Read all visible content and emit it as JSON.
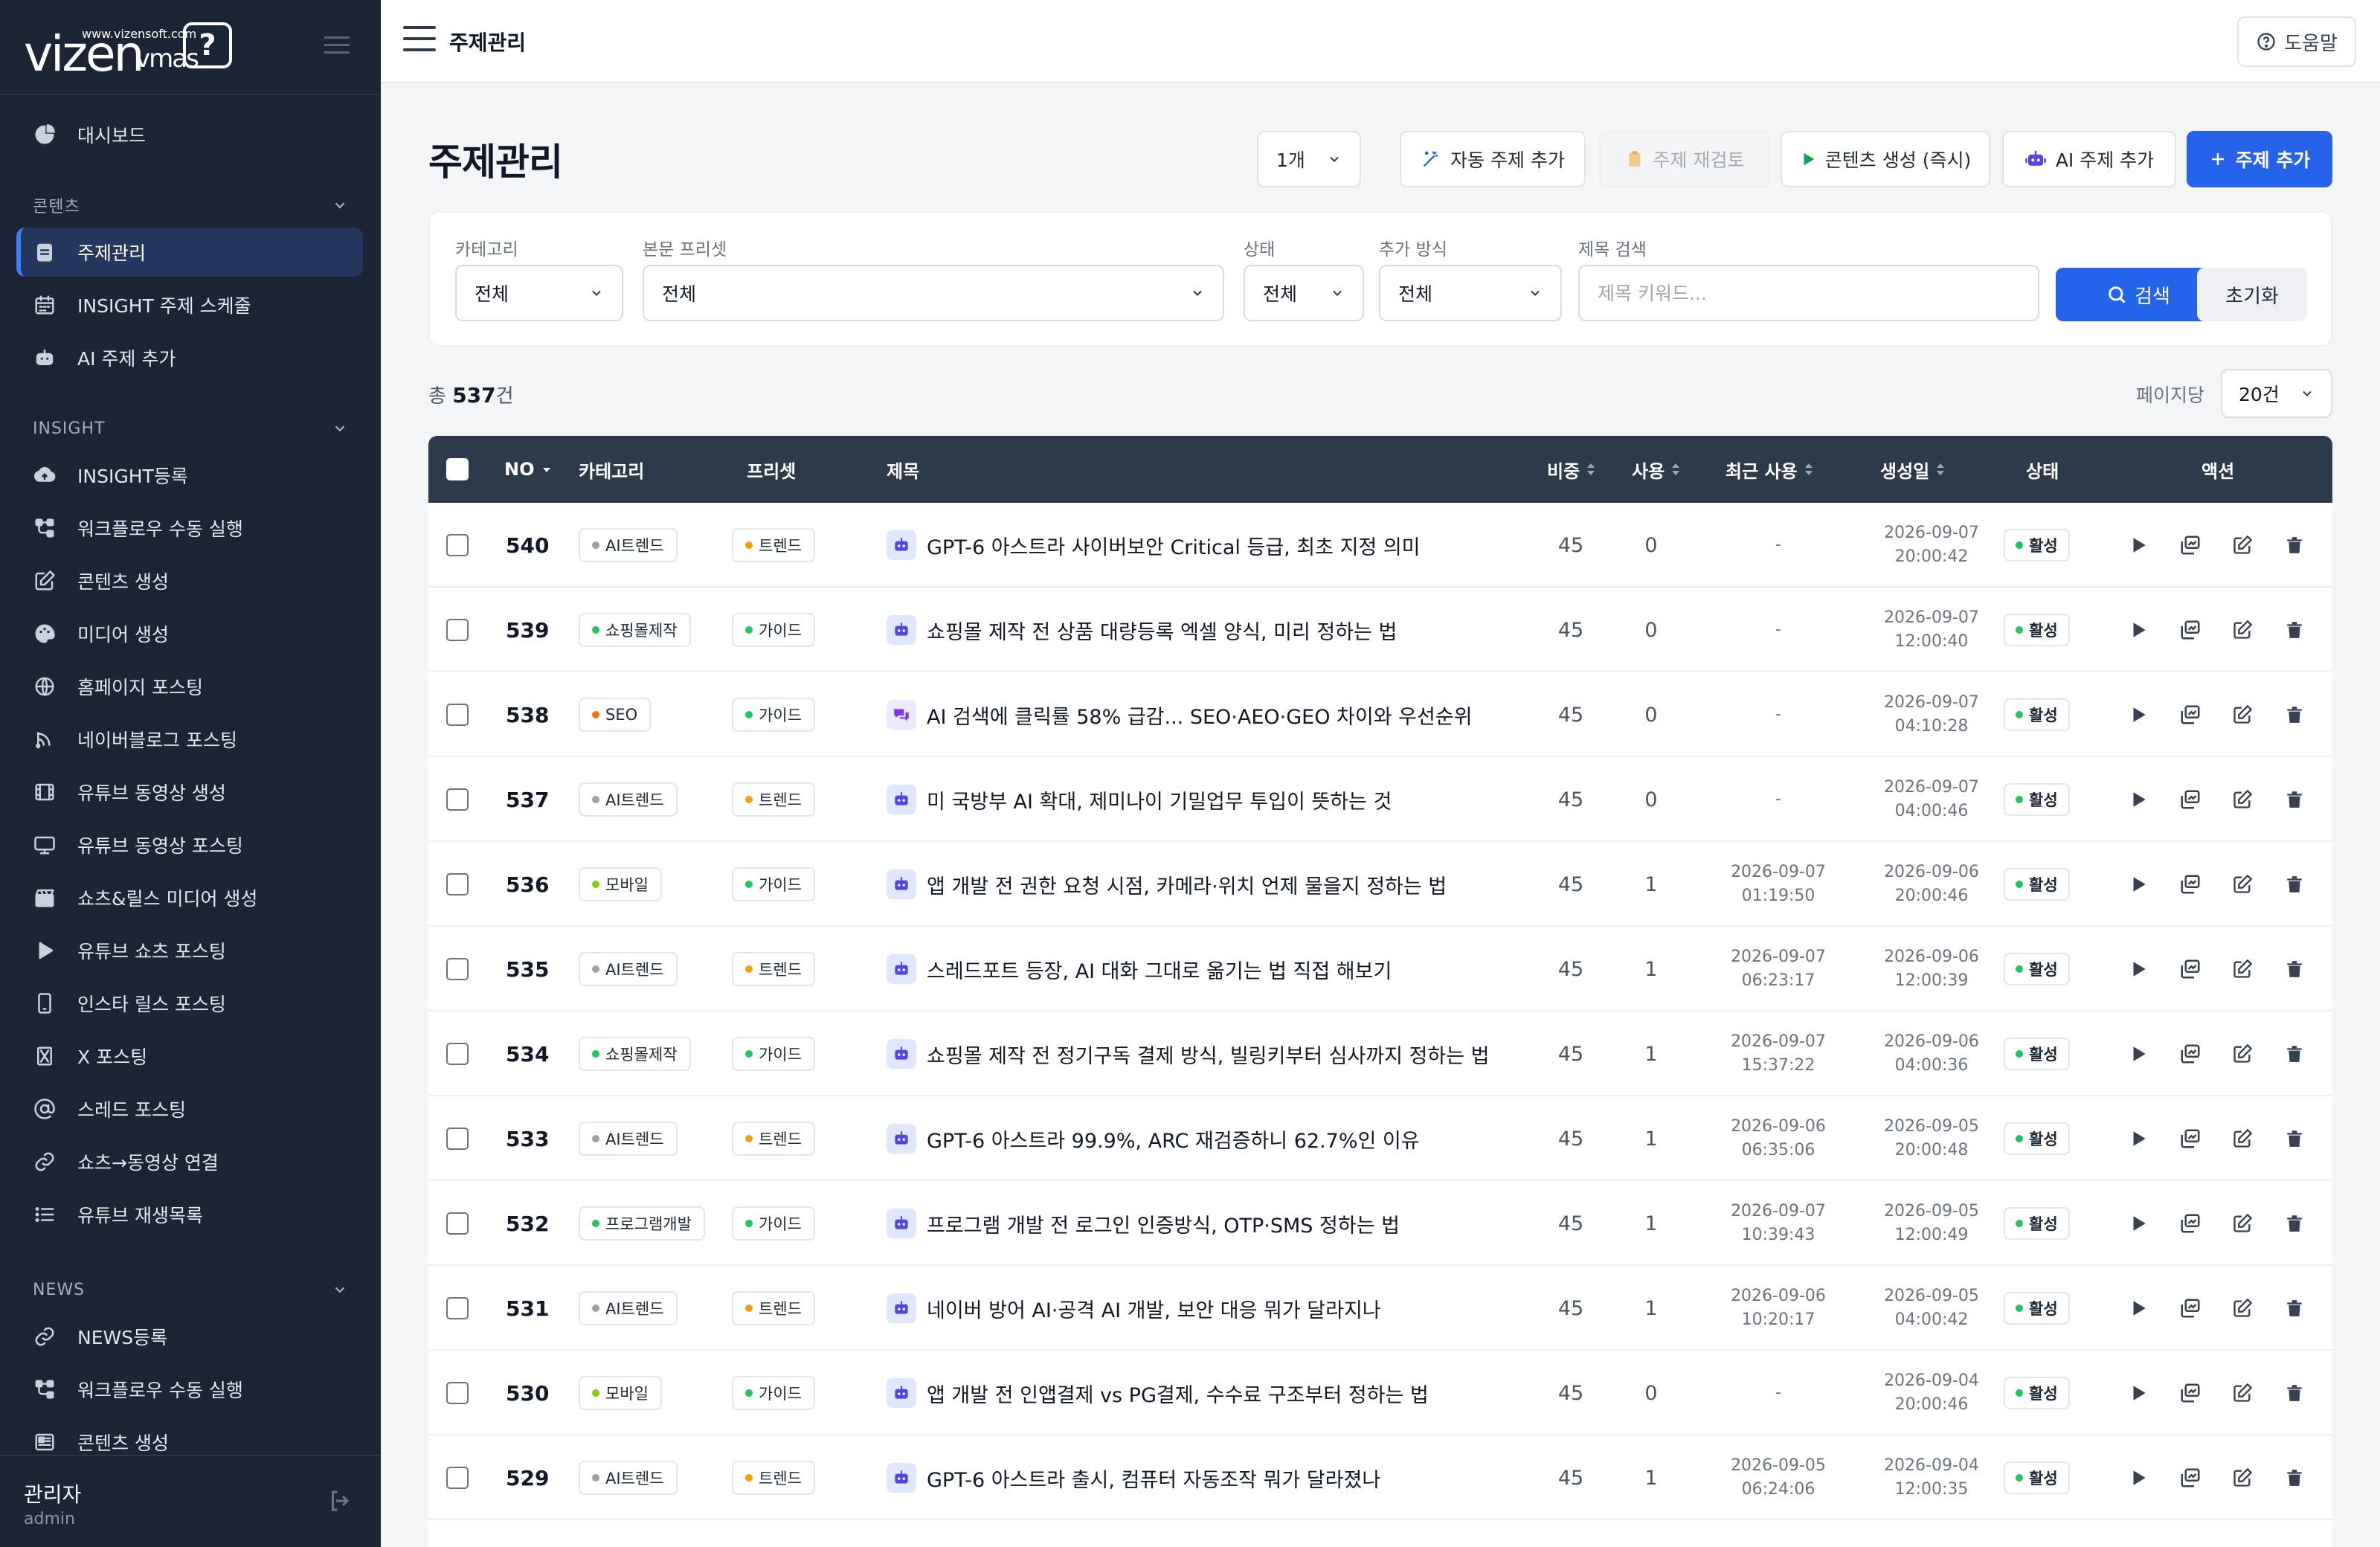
{
  "brand": {
    "url": "www.vizensoft.com",
    "name_main": "vizen",
    "name_sub": "vmas",
    "mark": "?"
  },
  "sidebar": {
    "top_items": [
      {
        "label": "대시보드",
        "icon": "pie-chart-icon"
      }
    ],
    "sections": [
      {
        "title": "콘텐츠",
        "items": [
          {
            "label": "주제관리",
            "icon": "clipboard-icon",
            "active": true
          },
          {
            "label": "INSIGHT 주제 스케줄",
            "icon": "calendar-icon"
          },
          {
            "label": "AI 주제 추가",
            "icon": "robot-icon"
          }
        ]
      },
      {
        "title": "INSIGHT",
        "items": [
          {
            "label": "INSIGHT등록",
            "icon": "cloud-upload-icon"
          },
          {
            "label": "워크플로우 수동 실행",
            "icon": "workflow-icon"
          },
          {
            "label": "콘텐츠 생성",
            "icon": "edit-icon"
          },
          {
            "label": "미디어 생성",
            "icon": "palette-icon"
          },
          {
            "label": "홈페이지 포스팅",
            "icon": "globe-icon"
          },
          {
            "label": "네이버블로그 포스팅",
            "icon": "blog-icon"
          },
          {
            "label": "유튜브 동영상 생성",
            "icon": "film-icon"
          },
          {
            "label": "유튜브 동영상 포스팅",
            "icon": "monitor-icon"
          },
          {
            "label": "쇼츠&릴스 미디어 생성",
            "icon": "clapper-icon"
          },
          {
            "label": "유튜브 쇼츠 포스팅",
            "icon": "play-icon"
          },
          {
            "label": "인스타 릴스 포스팅",
            "icon": "phone-icon"
          },
          {
            "label": "X 포스팅",
            "icon": "x-icon"
          },
          {
            "label": "스레드 포스팅",
            "icon": "at-icon"
          },
          {
            "label": "쇼츠→동영상 연결",
            "icon": "link-icon"
          },
          {
            "label": "유튜브 재생목록",
            "icon": "list-icon"
          }
        ]
      },
      {
        "title": "NEWS",
        "items": [
          {
            "label": "NEWS등록",
            "icon": "link-icon"
          },
          {
            "label": "워크플로우 수동 실행",
            "icon": "workflow-icon"
          },
          {
            "label": "콘텐츠 생성",
            "icon": "newspaper-icon"
          }
        ]
      }
    ],
    "user": {
      "name": "관리자",
      "role": "admin"
    }
  },
  "topbar": {
    "title": "주제관리",
    "help": "도움말"
  },
  "page": {
    "title": "주제관리"
  },
  "toolbar": {
    "count": "1개",
    "auto_add": "자동 주제 추가",
    "review": "주제 재검토",
    "generate": "콘텐츠 생성 (즉시)",
    "ai_add": "AI 주제 추가",
    "add": "주제 추가"
  },
  "filters": {
    "category": {
      "label": "카테고리",
      "value": "전체"
    },
    "preset": {
      "label": "본문 프리셋",
      "value": "전체"
    },
    "status": {
      "label": "상태",
      "value": "전체"
    },
    "method": {
      "label": "추가 방식",
      "value": "전체"
    },
    "search": {
      "label": "제목 검색",
      "placeholder": "제목 키워드..."
    },
    "search_btn": "검색",
    "reset_btn": "초기화"
  },
  "summary": {
    "prefix": "총",
    "total": "537",
    "suffix": "건",
    "per_page_label": "페이지당",
    "per_page": "20건"
  },
  "table": {
    "headers": {
      "no": "NO",
      "category": "카테고리",
      "preset": "프리셋",
      "title": "제목",
      "weight": "비중",
      "usage": "사용",
      "last_used": "최근 사용",
      "created": "생성일",
      "status": "상태",
      "actions": "액션"
    },
    "dot_colors": {
      "AI트렌드": "#9ca3af",
      "쇼핑몰제작": "#22c55e",
      "SEO": "#f97316",
      "모바일": "#84cc16",
      "프로그램개발": "#22c55e",
      "트렌드": "#f59e0b",
      "가이드": "#22c55e",
      "활성": "#22c55e"
    },
    "rows": [
      {
        "no": "540",
        "category": "AI트렌드",
        "preset": "트렌드",
        "icon": "robot",
        "title": "GPT-6 아스트라 사이버보안 Critical 등급, 최초 지정 의미",
        "weight": "45",
        "usage": "0",
        "last_used": [
          "-"
        ],
        "created": [
          "2026-09-07",
          "20:00:42"
        ],
        "status": "활성"
      },
      {
        "no": "539",
        "category": "쇼핑몰제작",
        "preset": "가이드",
        "icon": "robot",
        "title": "쇼핑몰 제작 전 상품 대량등록 엑셀 양식, 미리 정하는 법",
        "weight": "45",
        "usage": "0",
        "last_used": [
          "-"
        ],
        "created": [
          "2026-09-07",
          "12:00:40"
        ],
        "status": "활성"
      },
      {
        "no": "538",
        "category": "SEO",
        "preset": "가이드",
        "icon": "chat",
        "title": "AI 검색에 클릭률 58% 급감... SEO·AEO·GEO 차이와 우선순위",
        "weight": "45",
        "usage": "0",
        "last_used": [
          "-"
        ],
        "created": [
          "2026-09-07",
          "04:10:28"
        ],
        "status": "활성"
      },
      {
        "no": "537",
        "category": "AI트렌드",
        "preset": "트렌드",
        "icon": "robot",
        "title": "미 국방부 AI 확대, 제미나이 기밀업무 투입이 뜻하는 것",
        "weight": "45",
        "usage": "0",
        "last_used": [
          "-"
        ],
        "created": [
          "2026-09-07",
          "04:00:46"
        ],
        "status": "활성"
      },
      {
        "no": "536",
        "category": "모바일",
        "preset": "가이드",
        "icon": "robot",
        "title": "앱 개발 전 권한 요청 시점, 카메라·위치 언제 물을지 정하는 법",
        "weight": "45",
        "usage": "1",
        "last_used": [
          "2026-09-07",
          "01:19:50"
        ],
        "created": [
          "2026-09-06",
          "20:00:46"
        ],
        "status": "활성"
      },
      {
        "no": "535",
        "category": "AI트렌드",
        "preset": "트렌드",
        "icon": "robot",
        "title": "스레드포트 등장, AI 대화 그대로 옮기는 법 직접 해보기",
        "weight": "45",
        "usage": "1",
        "last_used": [
          "2026-09-07",
          "06:23:17"
        ],
        "created": [
          "2026-09-06",
          "12:00:39"
        ],
        "status": "활성"
      },
      {
        "no": "534",
        "category": "쇼핑몰제작",
        "preset": "가이드",
        "icon": "robot",
        "title": "쇼핑몰 제작 전 정기구독 결제 방식, 빌링키부터 심사까지 정하는 법",
        "weight": "45",
        "usage": "1",
        "last_used": [
          "2026-09-07",
          "15:37:22"
        ],
        "created": [
          "2026-09-06",
          "04:00:36"
        ],
        "status": "활성"
      },
      {
        "no": "533",
        "category": "AI트렌드",
        "preset": "트렌드",
        "icon": "robot",
        "title": "GPT-6 아스트라 99.9%, ARC 재검증하니 62.7%인 이유",
        "weight": "45",
        "usage": "1",
        "last_used": [
          "2026-09-06",
          "06:35:06"
        ],
        "created": [
          "2026-09-05",
          "20:00:48"
        ],
        "status": "활성"
      },
      {
        "no": "532",
        "category": "프로그램개발",
        "preset": "가이드",
        "icon": "robot",
        "title": "프로그램 개발 전 로그인 인증방식, OTP·SMS 정하는 법",
        "weight": "45",
        "usage": "1",
        "last_used": [
          "2026-09-07",
          "10:39:43"
        ],
        "created": [
          "2026-09-05",
          "12:00:49"
        ],
        "status": "활성"
      },
      {
        "no": "531",
        "category": "AI트렌드",
        "preset": "트렌드",
        "icon": "robot",
        "title": "네이버 방어 AI·공격 AI 개발, 보안 대응 뭐가 달라지나",
        "weight": "45",
        "usage": "1",
        "last_used": [
          "2026-09-06",
          "10:20:17"
        ],
        "created": [
          "2026-09-05",
          "04:00:42"
        ],
        "status": "활성"
      },
      {
        "no": "530",
        "category": "모바일",
        "preset": "가이드",
        "icon": "robot",
        "title": "앱 개발 전 인앱결제 vs PG결제, 수수료 구조부터 정하는 법",
        "weight": "45",
        "usage": "0",
        "last_used": [
          "-"
        ],
        "created": [
          "2026-09-04",
          "20:00:46"
        ],
        "status": "활성"
      },
      {
        "no": "529",
        "category": "AI트렌드",
        "preset": "트렌드",
        "icon": "robot",
        "title": "GPT-6 아스트라 출시, 컴퓨터 자동조작 뭐가 달라졌나",
        "weight": "45",
        "usage": "1",
        "last_used": [
          "2026-09-05",
          "06:24:06"
        ],
        "created": [
          "2026-09-04",
          "12:00:35"
        ],
        "status": "활성"
      }
    ]
  }
}
